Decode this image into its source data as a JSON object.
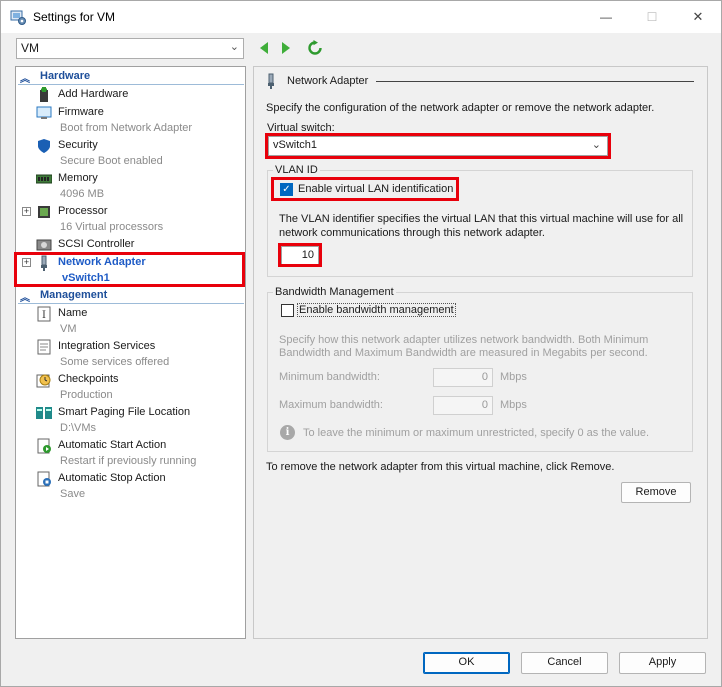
{
  "window": {
    "title": "Settings for VM",
    "minimize_glyph": "—",
    "maximize_glyph": "☐",
    "close_glyph": "✕"
  },
  "toolbar": {
    "vm_selector": "VM",
    "back_icon": "green-left-arrow-icon",
    "forward_icon": "green-right-arrow-icon",
    "refresh_icon": "green-refresh-icon"
  },
  "sidebar": {
    "hardware_header": "Hardware",
    "management_header": "Management",
    "hardware_items": [
      {
        "name": "Add Hardware",
        "sub": "",
        "icon": "add-hardware-icon"
      },
      {
        "name": "Firmware",
        "sub": "Boot from Network Adapter",
        "icon": "firmware-icon"
      },
      {
        "name": "Security",
        "sub": "Secure Boot enabled",
        "icon": "shield-icon"
      },
      {
        "name": "Memory",
        "sub": "4096 MB",
        "icon": "memory-icon"
      },
      {
        "name": "Processor",
        "sub": "16 Virtual processors",
        "icon": "processor-icon"
      },
      {
        "name": "SCSI Controller",
        "sub": "",
        "icon": "scsi-controller-icon"
      },
      {
        "name": "Network Adapter",
        "sub": "vSwitch1",
        "icon": "network-adapter-icon"
      }
    ],
    "management_items": [
      {
        "name": "Name",
        "sub": "VM",
        "icon": "name-icon"
      },
      {
        "name": "Integration Services",
        "sub": "Some services offered",
        "icon": "integration-services-icon"
      },
      {
        "name": "Checkpoints",
        "sub": "Production",
        "icon": "checkpoints-icon"
      },
      {
        "name": "Smart Paging File Location",
        "sub": "D:\\VMs",
        "icon": "smart-paging-icon"
      },
      {
        "name": "Automatic Start Action",
        "sub": "Restart if previously running",
        "icon": "automatic-start-icon"
      },
      {
        "name": "Automatic Stop Action",
        "sub": "Save",
        "icon": "automatic-stop-icon"
      }
    ]
  },
  "panel": {
    "title": "Network Adapter",
    "description": "Specify the configuration of the network adapter or remove the network adapter.",
    "virtual_switch_label": "Virtual switch:",
    "virtual_switch_value": "vSwitch1",
    "vlan_group_label": "VLAN ID",
    "vlan_checkbox_label": "Enable virtual LAN identification",
    "vlan_checked": true,
    "vlan_desc_line1": "The VLAN identifier specifies the virtual LAN that this virtual machine will use for all",
    "vlan_desc_line2": "network communications through this network adapter.",
    "vlan_value": "10",
    "bandwidth_group_label": "Bandwidth Management",
    "bandwidth_checkbox_label": "Enable bandwidth management",
    "bandwidth_checked": false,
    "bandwidth_desc_line1": "Specify how this network adapter utilizes network bandwidth. Both Minimum",
    "bandwidth_desc_line2": "Bandwidth and Maximum Bandwidth are measured in Megabits per second.",
    "min_bandwidth_label": "Minimum bandwidth:",
    "min_bandwidth_value": "0",
    "max_bandwidth_label": "Maximum bandwidth:",
    "max_bandwidth_value": "0",
    "unit": "Mbps",
    "info_text": "To leave the minimum or maximum unrestricted, specify 0 as the value.",
    "remove_text": "To remove the network adapter from this virtual machine, click Remove.",
    "remove_button": "Remove"
  },
  "footer": {
    "ok": "OK",
    "cancel": "Cancel",
    "apply": "Apply"
  },
  "colors": {
    "accent": "#0067c0",
    "highlight_red": "#e8000b",
    "section_blue": "#1e4f9a",
    "selected_text": "#1e5bc6"
  }
}
